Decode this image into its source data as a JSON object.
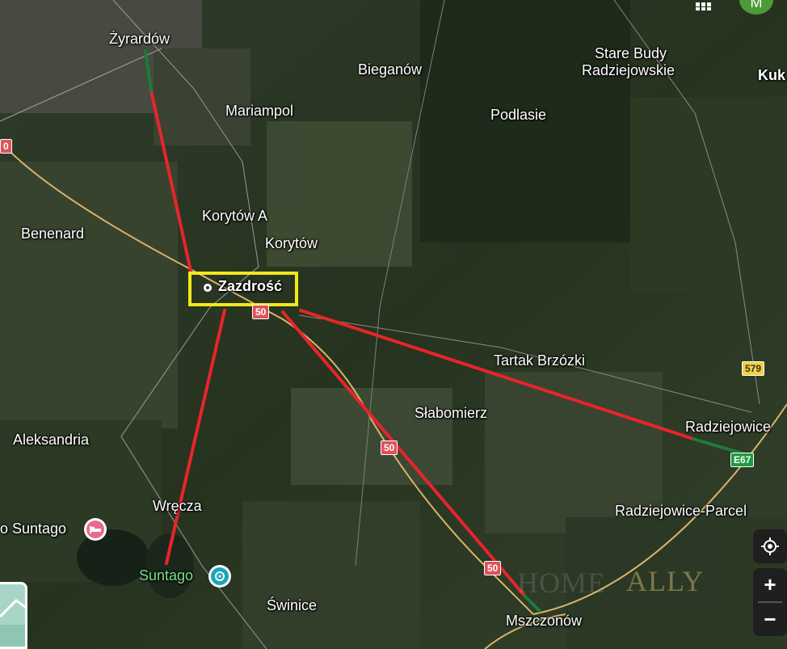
{
  "map": {
    "background": "#2a3a26",
    "highlight_color": "#f1e81c",
    "line_color": "#e8242b",
    "line_end_color": "#1f7a3a"
  },
  "selected_place": {
    "label": "Zazdrość",
    "icon": "pin-icon"
  },
  "places": {
    "zyrardow": "Żyrardów",
    "bieganow": "Bieganów",
    "stare_budy_1": "Stare Budy",
    "stare_budy_2": "Radziejowskie",
    "kuk": "Kuk",
    "mariampol": "Mariampol",
    "podlasie": "Podlasie",
    "korytow_a": "Korytów A",
    "korytow": "Korytów",
    "benenard": "Benenard",
    "tartak": "Tartak Brzózki",
    "slabomierz": "Słabomierz",
    "radziejowice": "Radziejowice",
    "aleksandria": "Aleksandria",
    "radziejowice_parcel": "Radziejowice-Parcel",
    "wrecza": "Wręcza",
    "suntago_hotel": "o Suntago",
    "suntago": "Suntago",
    "swinice": "Świnice",
    "mszczonow": "Mszczonów"
  },
  "road_shields": {
    "r50_a": "50",
    "r50_b": "50",
    "r50_c": "50",
    "r50_left": "0",
    "r579": "579",
    "e67": "E67"
  },
  "poi_icons": {
    "hotel": "bed-icon",
    "park": "waterpark-icon"
  },
  "controls": {
    "location": "my-location-icon",
    "zoom_in": "+",
    "zoom_out": "−",
    "apps": "apps-grid-icon",
    "avatar": "M"
  },
  "watermark": "ALLY",
  "watermark_faded": "HOME"
}
